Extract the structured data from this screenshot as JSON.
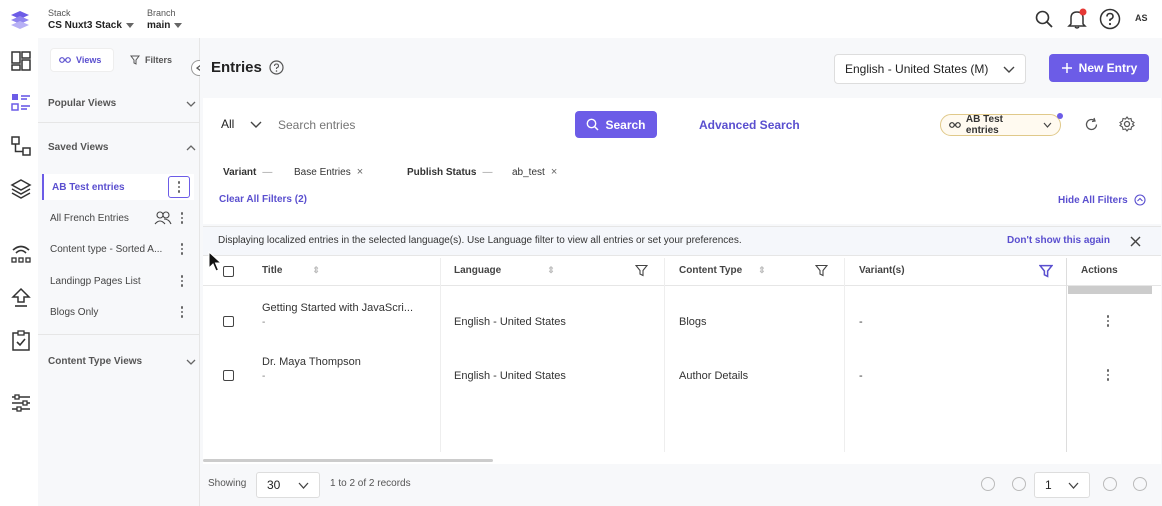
{
  "topbar": {
    "stack_label": "Stack",
    "stack_value": "CS Nuxt3 Stack",
    "branch_label": "Branch",
    "branch_value": "main",
    "avatar_initials": "AS"
  },
  "panel": {
    "views_tab": "Views",
    "filters_tab": "Filters",
    "popular_views": "Popular Views",
    "saved_views": "Saved Views",
    "saved_items": [
      "AB Test entries",
      "All French Entries",
      "Content type - Sorted A...",
      "Landingp Pages List",
      "Blogs Only"
    ],
    "content_type_views": "Content Type Views"
  },
  "header": {
    "title": "Entries",
    "locale": "English - United States (M)",
    "new_entry": "New Entry"
  },
  "search": {
    "scope": "All",
    "placeholder": "Search entries",
    "search_button": "Search",
    "advanced": "Advanced Search",
    "current_view": "AB Test entries"
  },
  "filters": {
    "variant_label": "Variant",
    "variant_value": "Base Entries",
    "publish_label": "Publish Status",
    "publish_value": "ab_test",
    "clear_all": "Clear All Filters (2)",
    "hide_all": "Hide All Filters"
  },
  "banner": {
    "message": "Displaying localized entries in the selected language(s). Use Language filter to view all entries or set your preferences.",
    "dismiss": "Don't show this again"
  },
  "table": {
    "columns": [
      "Title",
      "Language",
      "Content Type",
      "Variant(s)",
      "Actions"
    ],
    "rows": [
      {
        "title": "Getting Started with JavaScri...",
        "subtitle": "-",
        "language": "English - United States",
        "content_type": "Blogs",
        "variants": "-"
      },
      {
        "title": "Dr. Maya Thompson",
        "subtitle": "-",
        "language": "English - United States",
        "content_type": "Author Details",
        "variants": "-"
      }
    ]
  },
  "footer": {
    "showing": "Showing",
    "page_size": "30",
    "records": "1 to 2 of 2 records",
    "page": "1"
  },
  "colors": {
    "accent": "#6c5ce7",
    "link": "#5a4fcf"
  }
}
